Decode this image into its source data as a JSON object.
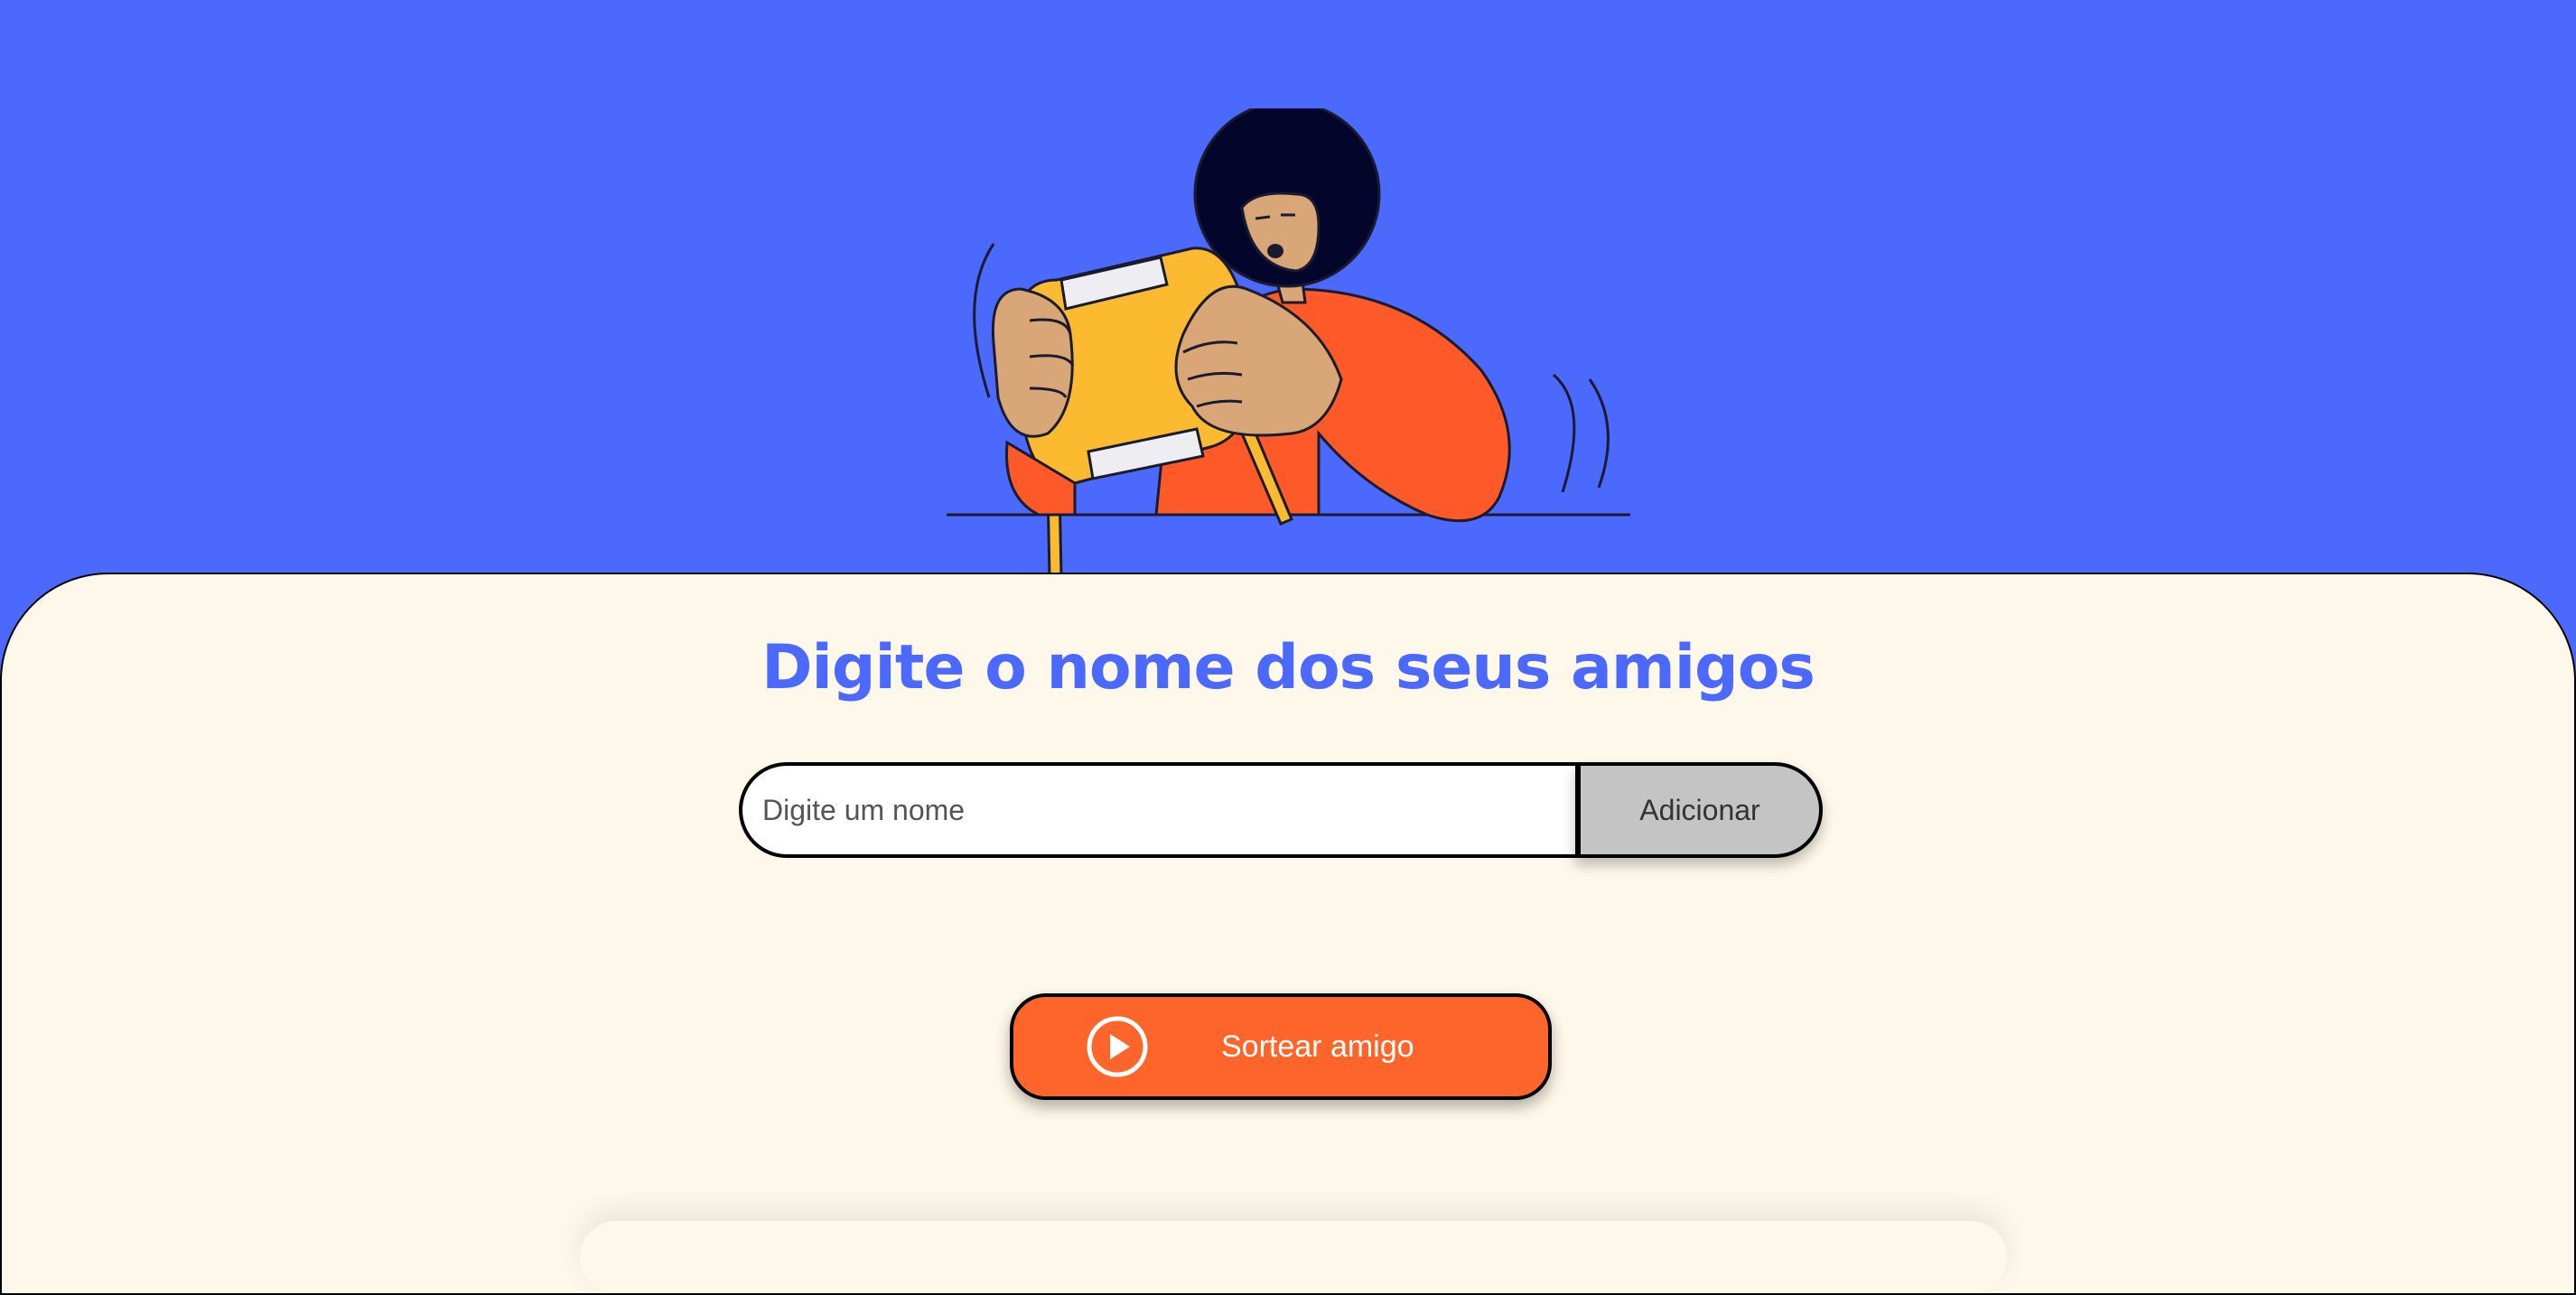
{
  "hero": {
    "illustration_icon": "person-with-gift-box-illustration"
  },
  "main": {
    "title": "Digite o nome dos seus amigos",
    "input": {
      "placeholder": "Digite um nome",
      "value": ""
    },
    "add_button_label": "Adicionar",
    "draw_button_label": "Sortear amigo",
    "draw_button_icon": "play-circle-icon"
  },
  "colors": {
    "primary_blue": "#4b69fd",
    "cream": "#fef8ea",
    "orange": "#fe652b",
    "gray_button": "#c4c4c4"
  }
}
